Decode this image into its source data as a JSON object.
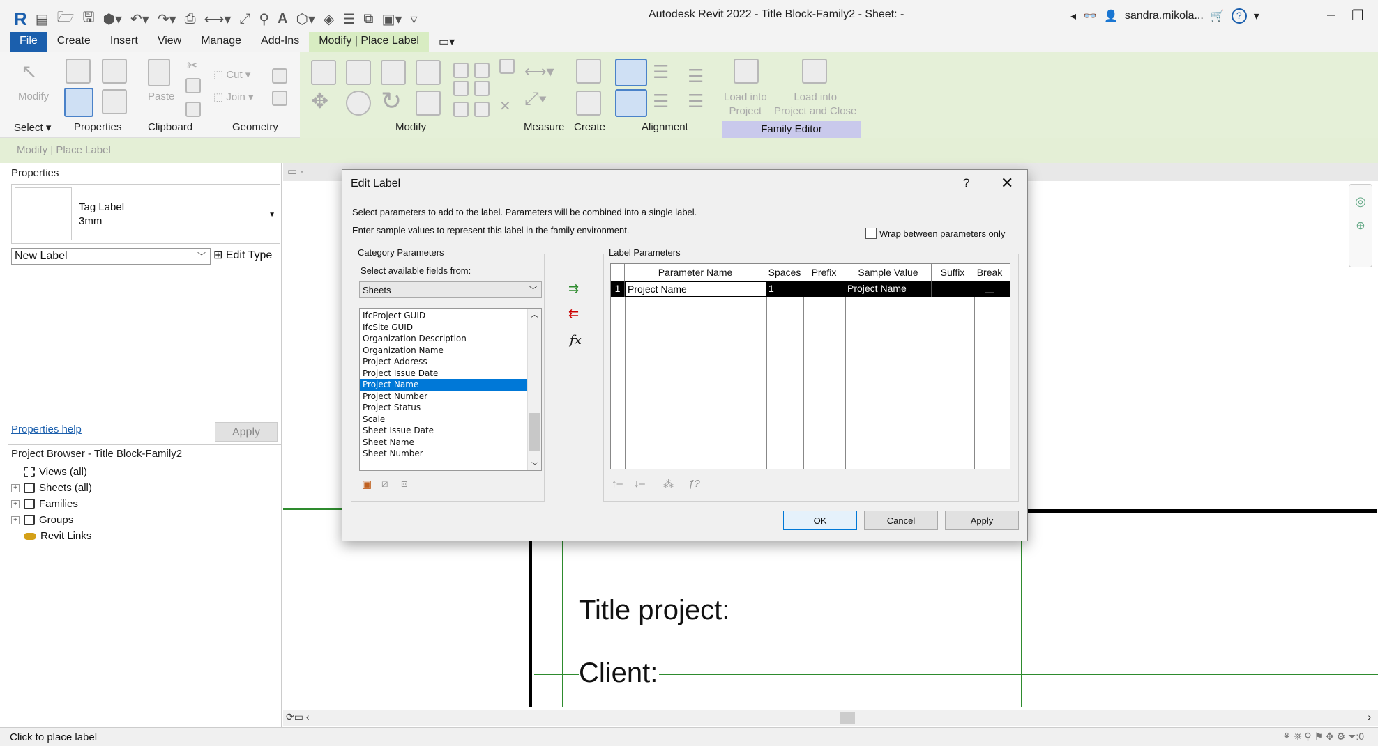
{
  "titlebar": {
    "title": "Autodesk Revit 2022 - Title Block-Family2 - Sheet: -",
    "user": "sandra.mikola...",
    "help": "?"
  },
  "tabs": [
    "File",
    "Create",
    "Insert",
    "View",
    "Manage",
    "Add-Ins",
    "Modify | Place Label"
  ],
  "ribbon": {
    "groups": [
      "Select",
      "Properties",
      "Clipboard",
      "Geometry",
      "Modify",
      "Measure",
      "Create",
      "Alignment"
    ],
    "family_editor": "Family Editor",
    "modify_btn": "Modify",
    "paste_btn": "Paste",
    "cut": "Cut",
    "join": "Join",
    "load_into_project": [
      "Load into",
      "Project"
    ],
    "load_close": [
      "Load into",
      "Project and Close"
    ]
  },
  "context_bar": "Modify | Place Label",
  "properties": {
    "header": "Properties",
    "type_name": "Tag Label",
    "type_size": "3mm",
    "instance_selector": "New Label",
    "edit_type": "Edit Type",
    "help_link": "Properties help",
    "apply": "Apply"
  },
  "browser": {
    "header": "Project Browser - Title Block-Family2",
    "items": [
      "Views (all)",
      "Sheets (all)",
      "Families",
      "Groups",
      "Revit Links"
    ]
  },
  "canvas": {
    "title_project": "Title project:",
    "client": "Client:"
  },
  "status": {
    "message": "Click to place label",
    "filter_count": ":0"
  },
  "dialog": {
    "title": "Edit Label",
    "help": "?",
    "instr1": "Select parameters to add to the label.  Parameters will be combined into a single label.",
    "instr2": "Enter sample values to represent this label in the family environment.",
    "wrap_label": "Wrap between parameters only",
    "category_group": "Category Parameters",
    "select_fields": "Select available fields from:",
    "category_value": "Sheets",
    "fields": [
      "IfcProject GUID",
      "IfcSite GUID",
      "Organization Description",
      "Organization Name",
      "Project Address",
      "Project Issue Date",
      "Project Name",
      "Project Number",
      "Project Status",
      "Scale",
      "Sheet Issue Date",
      "Sheet Name",
      "Sheet Number"
    ],
    "selected_field": "Project Name",
    "label_group": "Label Parameters",
    "columns": [
      "Parameter Name",
      "Spaces",
      "Prefix",
      "Sample Value",
      "Suffix",
      "Break"
    ],
    "rows": [
      {
        "num": "1",
        "param": "Project Name",
        "spaces": "1",
        "prefix": "",
        "sample": "Project Name",
        "suffix": ""
      }
    ],
    "fx": "fx",
    "ok": "OK",
    "cancel": "Cancel",
    "apply": "Apply"
  }
}
